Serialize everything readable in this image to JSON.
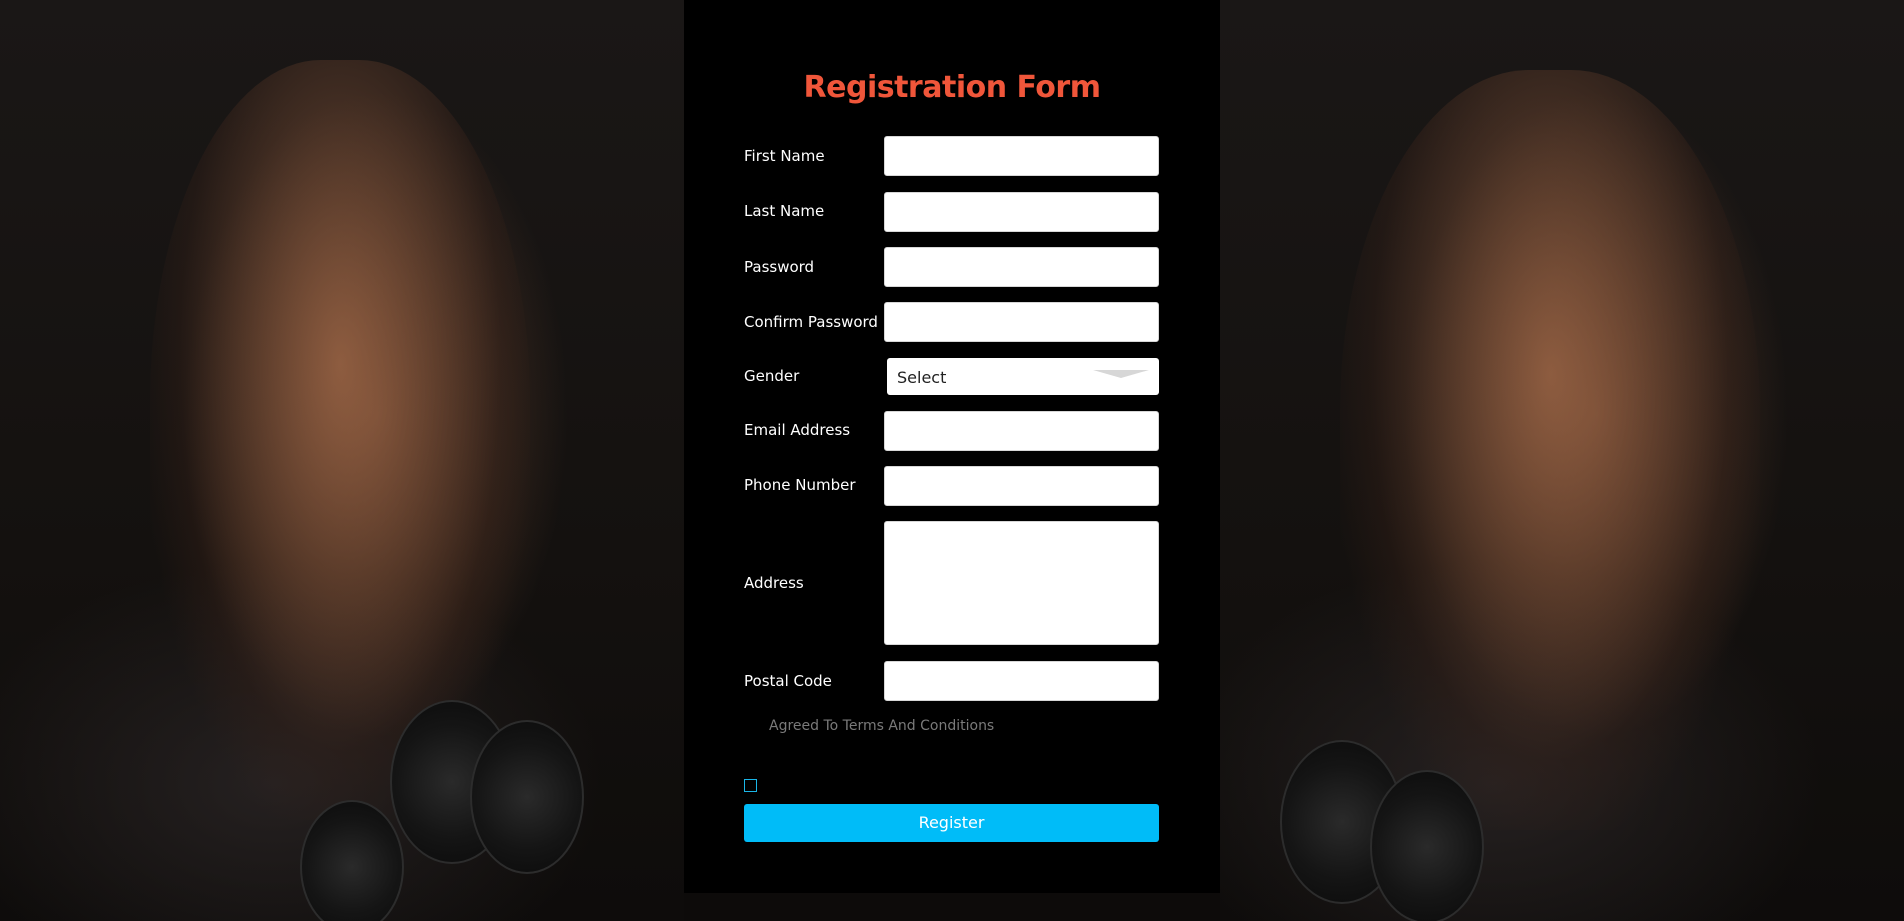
{
  "form": {
    "title": "Registration Form",
    "fields": {
      "first_name": {
        "label": "First Name",
        "value": ""
      },
      "last_name": {
        "label": "Last Name",
        "value": ""
      },
      "password": {
        "label": "Password",
        "value": ""
      },
      "confirm_password": {
        "label": "Confirm Password",
        "value": ""
      },
      "gender": {
        "label": "Gender",
        "value": "Select"
      },
      "email": {
        "label": "Email Address",
        "value": ""
      },
      "phone": {
        "label": "Phone Number",
        "value": ""
      },
      "address": {
        "label": "Address",
        "value": ""
      },
      "postal_code": {
        "label": "Postal Code",
        "value": ""
      }
    },
    "terms_label": "Agreed To Terms And Conditions",
    "register_label": "Register",
    "colors": {
      "title": "#f0563a",
      "button": "#00bcf8",
      "checkbox_border": "#1ab6e8"
    }
  }
}
